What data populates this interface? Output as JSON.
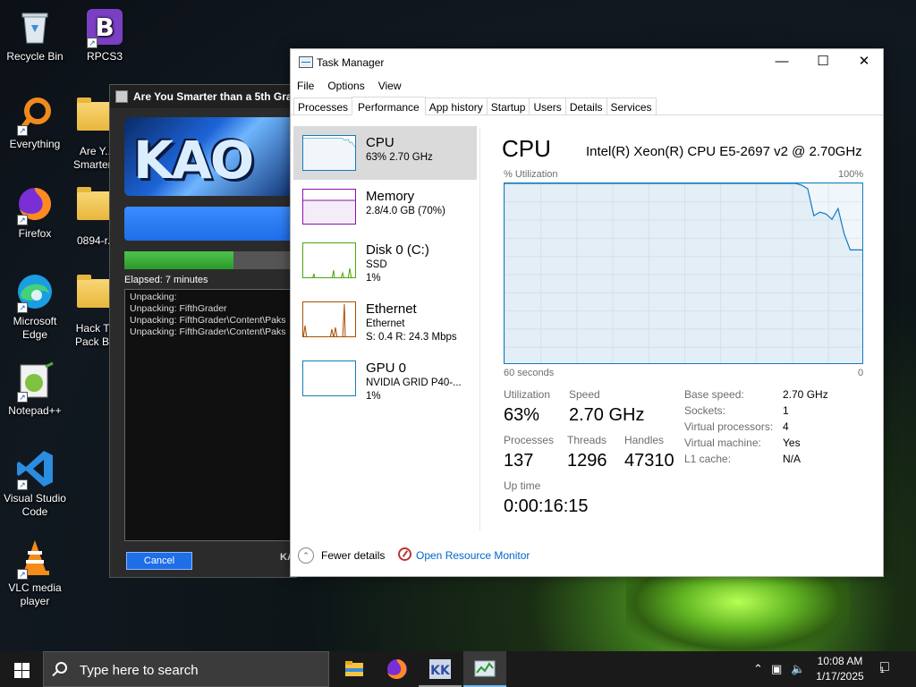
{
  "desktop": {
    "icons": [
      {
        "label": "Recycle Bin"
      },
      {
        "label": "RPCS3"
      },
      {
        "label": "Everything"
      },
      {
        "label": "Are Y... Smarter..."
      },
      {
        "label": "Firefox"
      },
      {
        "label": "0894-r..."
      },
      {
        "label": "Microsoft Edge"
      },
      {
        "label": "Hack T... Pack B..."
      },
      {
        "label": "Notepad++"
      },
      {
        "label": "Visual Studio Code"
      },
      {
        "label": "VLC media player"
      }
    ]
  },
  "installer": {
    "title": "Are You Smarter than a 5th Gra",
    "banner_text": "KAO",
    "progress_percent": 63,
    "elapsed": "Elapsed:  7 minutes",
    "log": [
      "Unpacking:",
      "Unpacking: FifthGrader",
      "Unpacking: FifthGrader\\Content\\Paks",
      "Unpacking: FifthGrader\\Content\\Paks"
    ],
    "cancel_label": "Cancel",
    "footer_text": "KA"
  },
  "taskmanager": {
    "title": "Task Manager",
    "menu": [
      "File",
      "Options",
      "View"
    ],
    "tabs": [
      "Processes",
      "Performance",
      "App history",
      "Startup",
      "Users",
      "Details",
      "Services"
    ],
    "active_tab": "Performance",
    "side": [
      {
        "name": "CPU",
        "sub1": "63%  2.70 GHz",
        "sub2": "",
        "color": "#117dbb"
      },
      {
        "name": "Memory",
        "sub1": "2.8/4.0 GB (70%)",
        "sub2": "",
        "color": "#8b12ae"
      },
      {
        "name": "Disk 0 (C:)",
        "sub1": "SSD",
        "sub2": "1%",
        "color": "#4da60c"
      },
      {
        "name": "Ethernet",
        "sub1": "Ethernet",
        "sub2": "S: 0.4  R: 24.3 Mbps",
        "color": "#a74f01"
      },
      {
        "name": "GPU 0",
        "sub1": "NVIDIA GRID P40-...",
        "sub2": "1%",
        "color": "#117dbb"
      }
    ],
    "main": {
      "title": "CPU",
      "cpu_name": "Intel(R) Xeon(R) CPU E5-2697 v2 @ 2.70GHz",
      "util_caption": "% Utilization",
      "max_caption": "100%",
      "time_caption": "60 seconds",
      "zero_caption": "0",
      "stats": {
        "utilization_label": "Utilization",
        "utilization": "63%",
        "speed_label": "Speed",
        "speed": "2.70 GHz",
        "processes_label": "Processes",
        "processes": "137",
        "threads_label": "Threads",
        "threads": "1296",
        "handles_label": "Handles",
        "handles": "47310",
        "uptime_label": "Up time",
        "uptime": "0:00:16:15"
      },
      "details": [
        {
          "k": "Base speed:",
          "v": "2.70 GHz"
        },
        {
          "k": "Sockets:",
          "v": "1"
        },
        {
          "k": "Virtual processors:",
          "v": "4"
        },
        {
          "k": "Virtual machine:",
          "v": "Yes"
        },
        {
          "k": "L1 cache:",
          "v": "N/A"
        }
      ]
    },
    "footer": {
      "fewer": "Fewer details",
      "monitor": "Open Resource Monitor"
    }
  },
  "cpu_history": [
    100,
    100,
    100,
    100,
    100,
    100,
    100,
    100,
    100,
    100,
    100,
    100,
    100,
    100,
    100,
    100,
    100,
    100,
    100,
    100,
    100,
    100,
    100,
    100,
    100,
    100,
    100,
    100,
    100,
    100,
    100,
    100,
    100,
    100,
    100,
    100,
    100,
    100,
    100,
    100,
    100,
    100,
    100,
    100,
    100,
    100,
    100,
    100,
    100,
    99,
    97,
    82,
    84,
    83,
    80,
    86,
    72,
    63,
    63,
    63
  ],
  "taskbar": {
    "search_placeholder": "Type here to search",
    "time": "10:08 AM",
    "date": "1/17/2025",
    "notification_count": "1"
  },
  "colors": {
    "accent": "#117dbb",
    "link": "#0066cc",
    "taskbar": "#1a1a1a"
  }
}
